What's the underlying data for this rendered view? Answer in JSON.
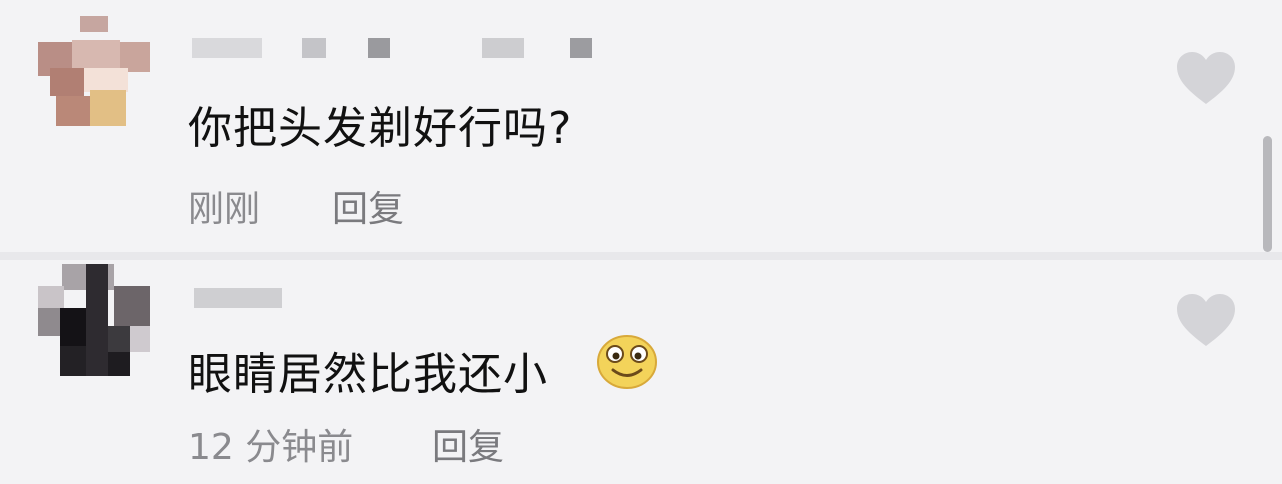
{
  "comments": [
    {
      "text": "你把头发剃好行吗?",
      "time": "刚刚",
      "reply_label": "回复",
      "like_icon": "heart-icon"
    },
    {
      "text": "眼睛居然比我还小",
      "emoji": "smiling-face-emoji",
      "time": "12 分钟前",
      "reply_label": "回复",
      "like_icon": "heart-icon"
    }
  ],
  "colors": {
    "text": "#111111",
    "meta": "#8a8a8e",
    "heart": "#d4d4d8",
    "background": "#f3f3f5"
  }
}
